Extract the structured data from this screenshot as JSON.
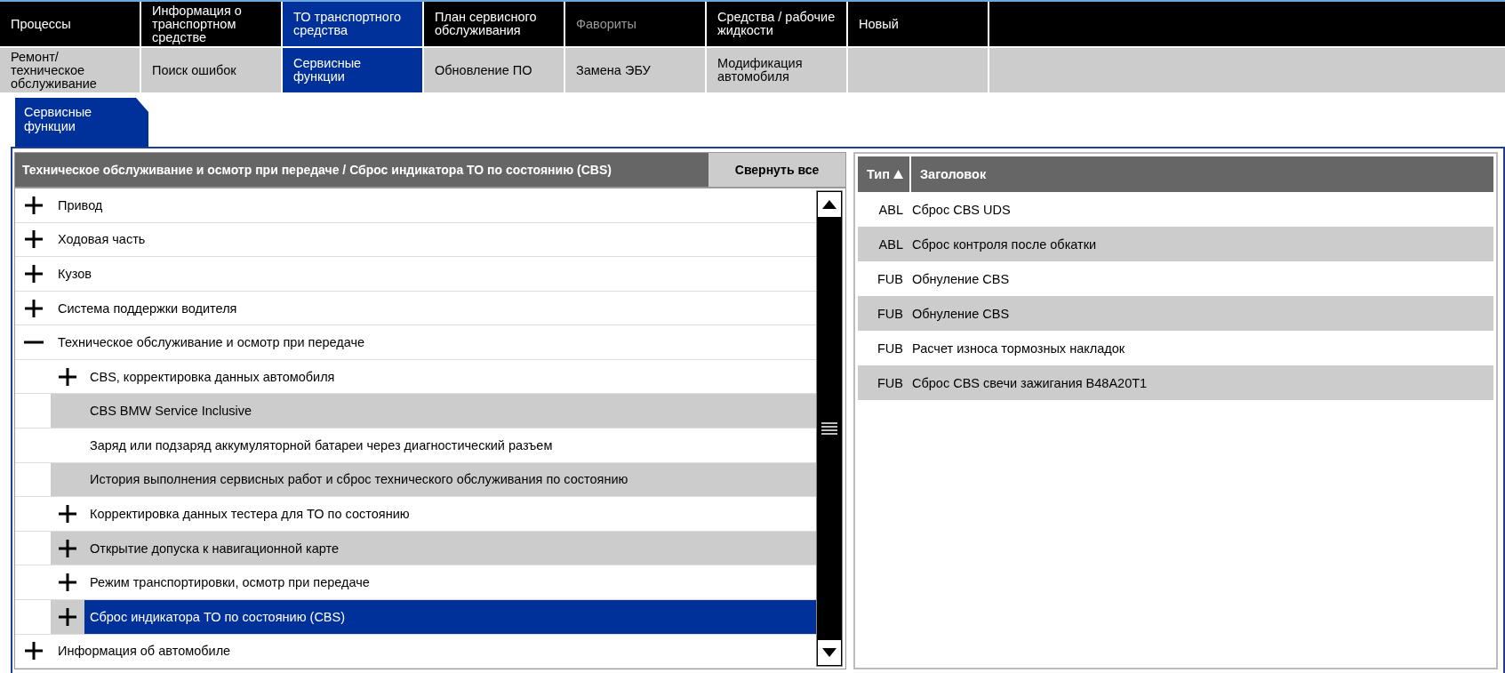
{
  "nav_primary": [
    {
      "label": "Процессы",
      "selected": false,
      "disabled": false
    },
    {
      "label": "Информация о транспортном средстве",
      "selected": false,
      "disabled": false
    },
    {
      "label": "ТО транспортного средства",
      "selected": true,
      "disabled": false
    },
    {
      "label": "План сервисного обслуживания",
      "selected": false,
      "disabled": false
    },
    {
      "label": "Фавориты",
      "selected": false,
      "disabled": true
    },
    {
      "label": "Средства / рабочие жидкости",
      "selected": false,
      "disabled": false
    },
    {
      "label": "Новый",
      "selected": false,
      "disabled": false
    }
  ],
  "nav_secondary": [
    {
      "label": "Ремонт/ техническое обслуживание",
      "selected": false
    },
    {
      "label": "Поиск ошибок",
      "selected": false
    },
    {
      "label": "Сервисные функции",
      "selected": true
    },
    {
      "label": "Обновление ПО",
      "selected": false
    },
    {
      "label": "Замена ЭБУ",
      "selected": false
    },
    {
      "label": "Модификация автомобиля",
      "selected": false
    }
  ],
  "sub_tabs": [
    {
      "label": "Сервисные функции",
      "selected": true
    }
  ],
  "tree_panel": {
    "breadcrumb": "Техническое обслуживание и осмотр при передаче / Сброс индикатора ТО по состоянию (CBS)",
    "collapse_all_button": "Свернуть все",
    "items": [
      {
        "label": "Привод",
        "kind": "group",
        "expanded": false,
        "selected": false
      },
      {
        "label": "Ходовая часть",
        "kind": "group",
        "expanded": false,
        "selected": false
      },
      {
        "label": "Кузов",
        "kind": "group",
        "expanded": false,
        "selected": false
      },
      {
        "label": "Система поддержки водителя",
        "kind": "group",
        "expanded": false,
        "selected": false
      },
      {
        "label": "Техническое обслуживание и осмотр при передаче",
        "kind": "group",
        "expanded": true,
        "selected": false,
        "children": [
          {
            "label": "CBS, корректировка данных автомобиля",
            "kind": "group",
            "expanded": false,
            "selected": false
          },
          {
            "label": "CBS BMW Service Inclusive",
            "kind": "leaf",
            "selected": false
          },
          {
            "label": "Заряд или подзаряд аккумуляторной батареи через диагностический разъем",
            "kind": "leaf",
            "selected": false
          },
          {
            "label": "История выполнения сервисных работ и сброс технического обслуживания по состоянию",
            "kind": "leaf",
            "selected": false
          },
          {
            "label": "Корректировка данных тестера для ТО по состоянию",
            "kind": "group",
            "expanded": false,
            "selected": false
          },
          {
            "label": "Открытие допуска к навигационной карте",
            "kind": "group",
            "expanded": false,
            "selected": false
          },
          {
            "label": "Режим транспортировки, осмотр при передаче",
            "kind": "group",
            "expanded": false,
            "selected": false
          },
          {
            "label": "Сброс индикатора ТО по состоянию (CBS)",
            "kind": "group",
            "expanded": false,
            "selected": true
          }
        ]
      },
      {
        "label": "Информация об автомобиле",
        "kind": "group",
        "expanded": false,
        "selected": false
      }
    ]
  },
  "results_table": {
    "columns": [
      {
        "label": "Тип",
        "sorted_ascending": true
      },
      {
        "label": "Заголовок",
        "sorted_ascending": false
      }
    ],
    "rows": [
      {
        "type": "ABL",
        "title": "Сброс CBS UDS"
      },
      {
        "type": "ABL",
        "title": "Сброс контроля после обкатки"
      },
      {
        "type": "FUB",
        "title": "Обнуление CBS"
      },
      {
        "type": "FUB",
        "title": "Обнуление CBS"
      },
      {
        "type": "FUB",
        "title": "Расчет износа тормозных накладок"
      },
      {
        "type": "FUB",
        "title": "Сброс CBS свечи зажигания B48A20T1"
      }
    ]
  }
}
